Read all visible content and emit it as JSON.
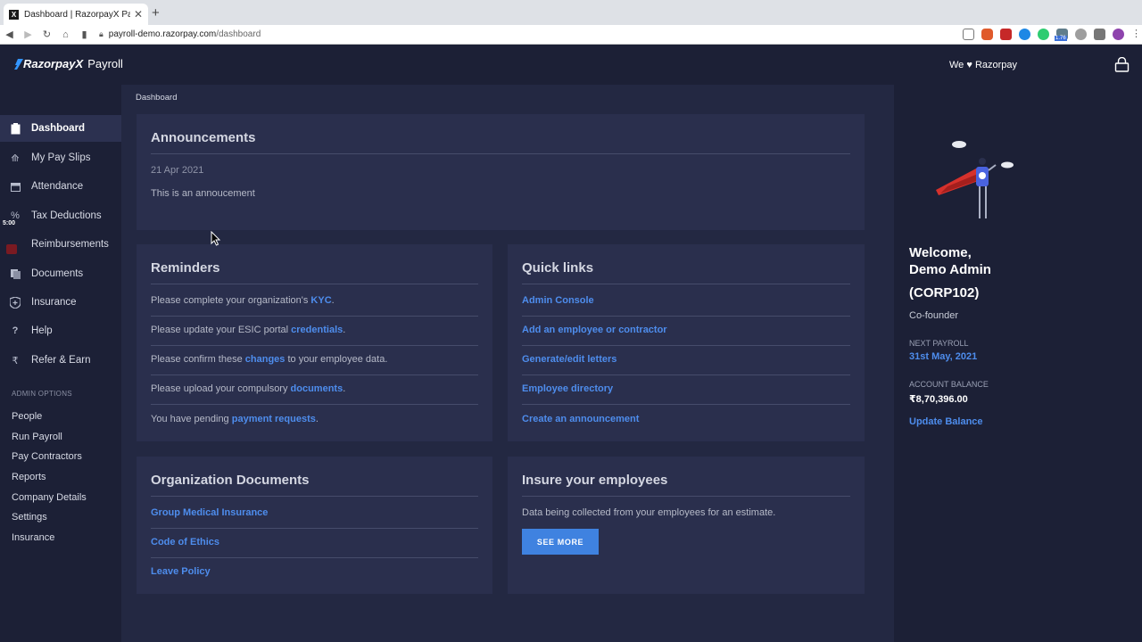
{
  "browser": {
    "tab_title": "Dashboard | RazorpayX Payroll",
    "tab_favicon": "X",
    "url_host": "payroll-demo.razorpay.com",
    "url_path": "/dashboard",
    "extension_badge": "1.76"
  },
  "header": {
    "logo_brand": "RazorpayX",
    "logo_product": "Payroll",
    "tagline_we": "We",
    "tagline_brand": "Razorpay",
    "heart_icon": "heart-icon"
  },
  "sidebar": {
    "items": [
      {
        "label": "Dashboard",
        "icon": "clipboard-icon",
        "active": true
      },
      {
        "label": "My Pay Slips",
        "icon": "payslip-icon"
      },
      {
        "label": "Attendance",
        "icon": "calendar-icon"
      },
      {
        "label": "Tax Deductions",
        "icon": "percent-icon"
      },
      {
        "label": "Reimbursements",
        "icon": "receipt-icon"
      },
      {
        "label": "Documents",
        "icon": "documents-icon"
      },
      {
        "label": "Insurance",
        "icon": "shield-icon"
      },
      {
        "label": "Help",
        "icon": "question-icon"
      },
      {
        "label": "Refer & Earn",
        "icon": "rupee-icon"
      }
    ],
    "timer": "5:00",
    "admin_title": "ADMIN OPTIONS",
    "admin_links": [
      "People",
      "Run Payroll",
      "Pay Contractors",
      "Reports",
      "Company Details",
      "Settings",
      "Insurance"
    ]
  },
  "breadcrumb": "Dashboard",
  "announcements": {
    "title": "Announcements",
    "date": "21 Apr 2021",
    "text": "This is an annoucement"
  },
  "reminders": {
    "title": "Reminders",
    "items": [
      {
        "pre": "Please complete your organization's ",
        "link": "KYC",
        "post": "."
      },
      {
        "pre": "Please update your ESIC portal ",
        "link": "credentials",
        "post": "."
      },
      {
        "pre": "Please confirm these ",
        "link": "changes",
        "post": " to your employee data."
      },
      {
        "pre": "Please upload your compulsory ",
        "link": "documents",
        "post": "."
      },
      {
        "pre": "You have pending ",
        "link": "payment requests",
        "post": "."
      }
    ]
  },
  "quick_links": {
    "title": "Quick links",
    "items": [
      "Admin Console",
      "Add an employee or contractor",
      "Generate/edit letters",
      "Employee directory",
      "Create an announcement"
    ]
  },
  "org_docs": {
    "title": "Organization Documents",
    "items": [
      "Group Medical Insurance",
      "Code of Ethics",
      "Leave Policy"
    ]
  },
  "insure": {
    "title": "Insure your employees",
    "text": "Data being collected from your employees for an estimate.",
    "button": "SEE MORE"
  },
  "profile": {
    "welcome_line1": "Welcome,",
    "welcome_line2": "Demo Admin",
    "emp_id": "(CORP102)",
    "role": "Co-founder",
    "next_payroll_label": "NEXT PAYROLL",
    "next_payroll_value": "31st May, 2021",
    "balance_label": "ACCOUNT BALANCE",
    "balance_value": "₹8,70,396.00",
    "update_label": "Update Balance"
  },
  "colors": {
    "accent": "#4e8ded",
    "sidebar_bg": "#1c2036",
    "main_bg": "#232842",
    "card_bg": "#2a2f4d"
  }
}
